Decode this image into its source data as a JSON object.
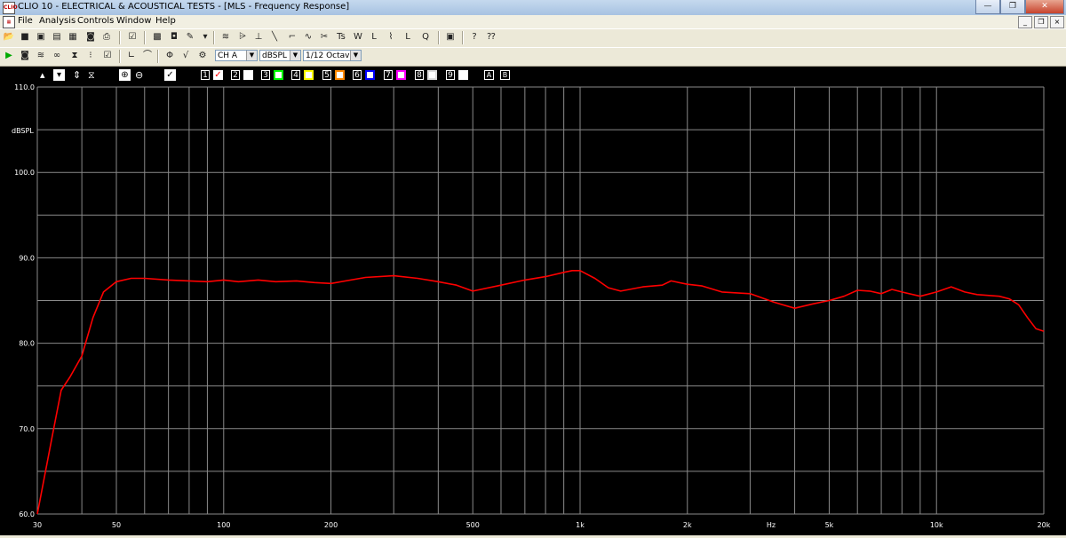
{
  "window": {
    "title": "CLIO 10 - ELECTRICAL & ACOUSTICAL TESTS - [MLS - Frequency Response]",
    "app_icon": "CLIO"
  },
  "menu": [
    "File",
    "Analysis",
    "Controls",
    "Window",
    "Help"
  ],
  "window_buttons": {
    "minimize": "—",
    "maximize": "❐",
    "close": "✕"
  },
  "toolbar2": {
    "channel_select": "CH A",
    "unit_select": "dBSPL",
    "smoothing_select": "1/12 Octave"
  },
  "graph_toolbar": {
    "curve_numbers": [
      "1",
      "2",
      "3",
      "4",
      "5",
      "6",
      "7",
      "8",
      "9"
    ],
    "overlay_colors": [
      "#ff0000",
      "#ffffff",
      "#00ff00",
      "#ffff00",
      "#ff8800",
      "#0000ff",
      "#ff00ff",
      "#dddddd",
      "#ffffff"
    ],
    "channel_letters": [
      "A",
      "B"
    ]
  },
  "colors": {
    "trace": "#ff0000",
    "grid": "#8a8a8a",
    "background": "#000000",
    "label": "#ffffff"
  },
  "chart_data": {
    "type": "line",
    "ylabel": "dBSPL",
    "xlabel": "Hz",
    "x_scale": "log",
    "xlim": [
      30,
      20000
    ],
    "ylim": [
      60,
      110
    ],
    "grid": true,
    "y_ticks": [
      "110.0",
      "100.0",
      "90.0",
      "80.0",
      "70.0",
      "60.0"
    ],
    "x_ticks": [
      "30",
      "50",
      "100",
      "200",
      "500",
      "1k",
      "2k",
      "5k",
      "10k",
      "20k"
    ],
    "series": [
      {
        "color": "#ff0000",
        "x": [
          30,
          33,
          35,
          37,
          40,
          43,
          46,
          50,
          55,
          60,
          70,
          80,
          90,
          100,
          110,
          125,
          140,
          160,
          180,
          200,
          250,
          300,
          350,
          400,
          450,
          500,
          600,
          700,
          800,
          900,
          950,
          1000,
          1100,
          1200,
          1300,
          1500,
          1700,
          1800,
          2000,
          2200,
          2500,
          3000,
          3500,
          4000,
          4500,
          5000,
          5500,
          6000,
          6500,
          7000,
          7500,
          8000,
          9000,
          10000,
          11000,
          12000,
          13000,
          15000,
          16000,
          17000,
          18000,
          19000,
          20000
        ],
        "y": [
          60.0,
          69.0,
          74.5,
          76.0,
          78.5,
          83.0,
          86.0,
          87.2,
          87.6,
          87.6,
          87.4,
          87.3,
          87.2,
          87.4,
          87.2,
          87.4,
          87.2,
          87.3,
          87.1,
          87.0,
          87.7,
          87.9,
          87.6,
          87.2,
          86.8,
          86.1,
          86.8,
          87.4,
          87.8,
          88.3,
          88.5,
          88.5,
          87.6,
          86.5,
          86.1,
          86.6,
          86.8,
          87.3,
          86.9,
          86.7,
          86.0,
          85.8,
          84.8,
          84.1,
          84.6,
          85.0,
          85.5,
          86.2,
          86.1,
          85.8,
          86.3,
          86.0,
          85.5,
          86.0,
          86.6,
          86.0,
          85.7,
          85.5,
          85.2,
          84.5,
          83.0,
          81.7,
          81.4
        ]
      }
    ]
  }
}
